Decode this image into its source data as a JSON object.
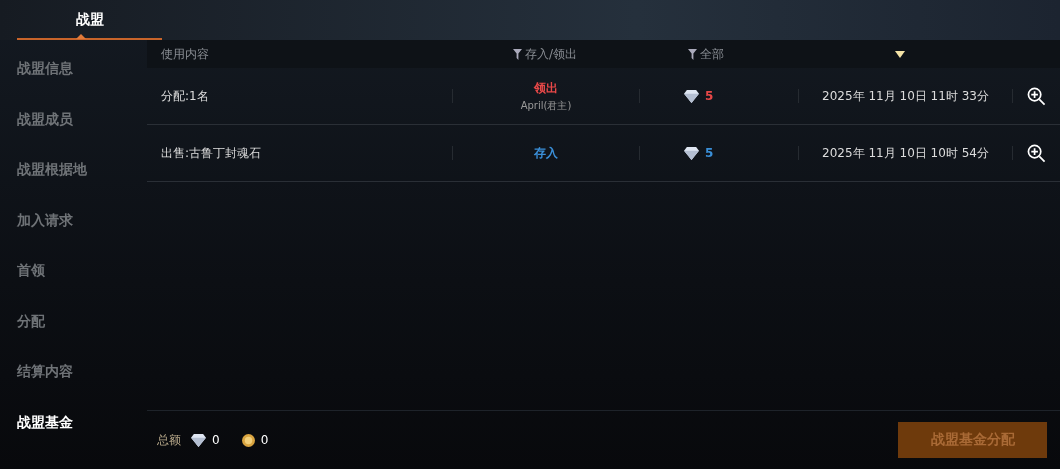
{
  "top_tabs": [
    {
      "label": "战盟",
      "selected": true
    }
  ],
  "sidebar": {
    "items": [
      {
        "label": "战盟信息",
        "selected": false
      },
      {
        "label": "战盟成员",
        "selected": false
      },
      {
        "label": "战盟根据地",
        "selected": false
      },
      {
        "label": "加入请求",
        "selected": false
      },
      {
        "label": "首领",
        "selected": false
      },
      {
        "label": "分配",
        "selected": false
      },
      {
        "label": "结算内容",
        "selected": false
      },
      {
        "label": "战盟基金",
        "selected": true
      }
    ]
  },
  "table": {
    "columns": [
      {
        "label": "使用内容",
        "filter": false
      },
      {
        "label": "存入/领出",
        "filter": true
      },
      {
        "label": "全部",
        "filter": true
      }
    ],
    "rows": [
      {
        "content": "分配:1名",
        "kind": "withdraw",
        "type": "领出",
        "by": "April(君主)",
        "amount": "5",
        "time": "2025年 11月 10日 11时 33分"
      },
      {
        "content": "出售:古鲁丁封魂石",
        "kind": "deposit",
        "type": "存入",
        "amount": "5",
        "time": "2025年 11月 10日 10时 54分"
      }
    ]
  },
  "footer": {
    "label": "总额",
    "diamonds": "0",
    "coins": "0",
    "button": {
      "label": "战盟基金分配",
      "disabled": true
    }
  }
}
